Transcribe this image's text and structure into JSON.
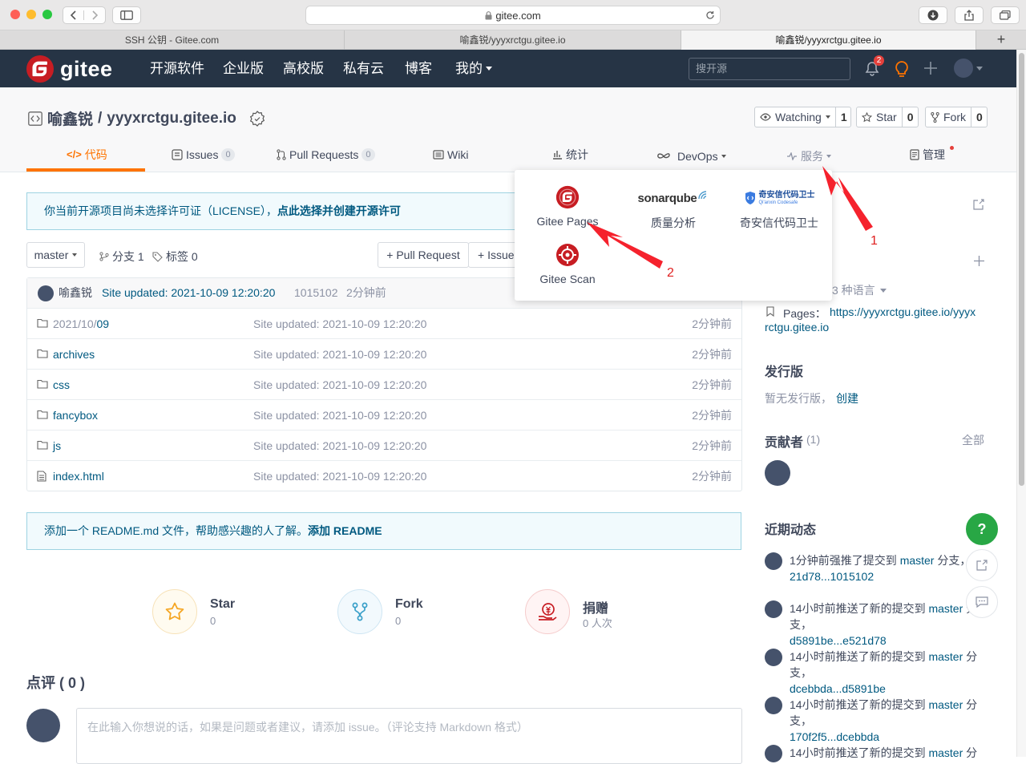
{
  "browser": {
    "url": "gitee.com",
    "tabs": [
      {
        "label": "SSH 公钥 - Gitee.com"
      },
      {
        "label": "喻鑫锐/yyyxrctgu.gitee.io"
      },
      {
        "label": "喻鑫锐/yyyxrctgu.gitee.io"
      }
    ]
  },
  "header": {
    "logo_text": "gitee",
    "nav": [
      "开源软件",
      "企业版",
      "高校版",
      "私有云",
      "博客",
      "我的"
    ],
    "search_placeholder": "搜开源",
    "notification_count": "2"
  },
  "repo": {
    "owner": "喻鑫锐",
    "sep": "/",
    "name": "yyyxrctgu.gitee.io",
    "watch_label": "Watching",
    "watch_count": "1",
    "star_label": "Star",
    "star_count": "0",
    "fork_label": "Fork",
    "fork_count": "0",
    "tabs": [
      {
        "label": "代码"
      },
      {
        "label": "Issues",
        "count": "0"
      },
      {
        "label": "Pull Requests",
        "count": "0"
      },
      {
        "label": "Wiki"
      },
      {
        "label": "统计"
      },
      {
        "label": "DevOps"
      },
      {
        "label": "服务"
      },
      {
        "label": "管理"
      }
    ]
  },
  "license_notice": {
    "text": "你当前开源项目尚未选择许可证（LICENSE），",
    "link": "点此选择并创建开源许可"
  },
  "toolbar": {
    "branch": "master",
    "branches": "分支 1",
    "tags": "标签 0",
    "pull_request": "+ Pull Request",
    "issue": "+ Issue"
  },
  "commit": {
    "author": "喻鑫锐",
    "message": "Site updated: 2021-10-09 12:20:20",
    "hash": "1015102",
    "time": "2分钟前"
  },
  "files": [
    {
      "name_prefix": "2021/10/",
      "name": "09",
      "message": "Site updated: 2021-10-09 12:20:20",
      "time": "2分钟前",
      "type": "folder"
    },
    {
      "name_prefix": "",
      "name": "archives",
      "message": "Site updated: 2021-10-09 12:20:20",
      "time": "2分钟前",
      "type": "folder"
    },
    {
      "name_prefix": "",
      "name": "css",
      "message": "Site updated: 2021-10-09 12:20:20",
      "time": "2分钟前",
      "type": "folder"
    },
    {
      "name_prefix": "",
      "name": "fancybox",
      "message": "Site updated: 2021-10-09 12:20:20",
      "time": "2分钟前",
      "type": "folder"
    },
    {
      "name_prefix": "",
      "name": "js",
      "message": "Site updated: 2021-10-09 12:20:20",
      "time": "2分钟前",
      "type": "folder"
    },
    {
      "name_prefix": "",
      "name": "index.html",
      "message": "Site updated: 2021-10-09 12:20:20",
      "time": "2分钟前",
      "type": "file"
    }
  ],
  "readme_notice": {
    "text": "添加一个 README.md 文件，帮助感兴趣的人了解。",
    "link": "添加 README"
  },
  "stats": [
    {
      "label": "Star",
      "value": "0"
    },
    {
      "label": "Fork",
      "value": "0"
    },
    {
      "label": "捐赠",
      "value": "0 人次"
    }
  ],
  "comments": {
    "title": "点评 ( 0 )",
    "placeholder": "在此输入你想说的话，如果是问题或者建议，请添加 issue。（评论支持 Markdown 格式）"
  },
  "dropdown": {
    "items": [
      {
        "label": "Gitee Pages"
      },
      {
        "label": "质量分析",
        "logo": "sonarqube"
      },
      {
        "label": "奇安信代码卫士",
        "logo_title": "奇安信代码卫士",
        "logo_sub": "Qi'anxin Codesafe"
      },
      {
        "label": "Gitee Scan"
      }
    ]
  },
  "annotations": {
    "arrow1": "1",
    "arrow2": "2"
  },
  "sidebar": {
    "languages": "3 种语言",
    "pages_label": "Pages：",
    "pages_url_1": "https://yyyxrctgu.gitee.io/yyyx",
    "pages_url_2": "rctgu.gitee.io",
    "releases_title": "发行版",
    "releases_text": "暂无发行版，",
    "releases_link": "创建",
    "contributors_title": "贡献者",
    "contributors_count": "(1)",
    "contributors_all": "全部",
    "activity_title": "近期动态",
    "activities": [
      {
        "pre": "1分钟前强推了提交到 ",
        "branch": "master",
        "post": " 分支，",
        "range": "21d78...1015102"
      },
      {
        "pre": "14小时前推送了新的提交到 ",
        "branch": "master",
        "post": " 分支，",
        "range": "d5891be...e521d78"
      },
      {
        "pre": "14小时前推送了新的提交到 ",
        "branch": "master",
        "post": " 分支，",
        "range": "dcebbda...d5891be"
      },
      {
        "pre": "14小时前推送了新的提交到 ",
        "branch": "master",
        "post": " 分支，",
        "range": "170f2f5...dcebbda"
      },
      {
        "pre": "14小时前推送了新的提交到 ",
        "branch": "master",
        "post": " 分",
        "range": ""
      }
    ]
  },
  "float": {
    "help": "?"
  },
  "colors": {
    "accent": "#fe7300",
    "header_bg": "#263445",
    "link": "#005980",
    "gitee_red": "#c71d23",
    "arrow": "#f5222d"
  }
}
